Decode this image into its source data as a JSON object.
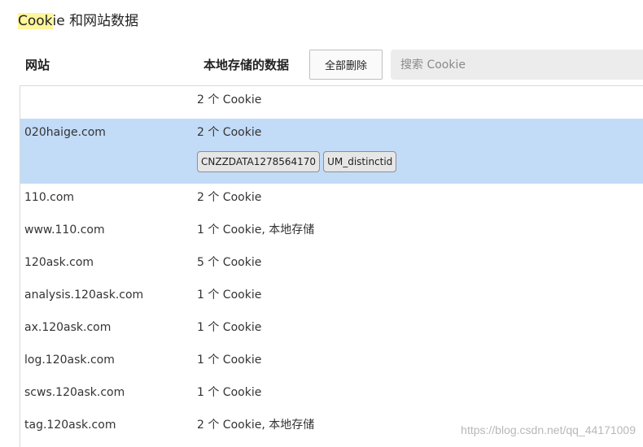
{
  "header": {
    "title_highlight": "Cook",
    "title_rest": "ie 和网站数据"
  },
  "toolbar": {
    "site_column": "网站",
    "data_column": "本地存储的数据",
    "delete_all_label": "全部删除",
    "search_placeholder": "搜索 Cookie"
  },
  "rows": [
    {
      "site": "",
      "data": "2 个 Cookie"
    },
    {
      "site": "020haige.com",
      "data": "2 个 Cookie",
      "selected": true,
      "cookies": [
        "CNZZDATA1278564170",
        "UM_distinctid"
      ]
    },
    {
      "site": "110.com",
      "data": "2 个 Cookie"
    },
    {
      "site": "www.110.com",
      "data": "1 个 Cookie, 本地存储"
    },
    {
      "site": "120ask.com",
      "data": "5 个 Cookie"
    },
    {
      "site": "analysis.120ask.com",
      "data": "1 个 Cookie"
    },
    {
      "site": "ax.120ask.com",
      "data": "1 个 Cookie"
    },
    {
      "site": "log.120ask.com",
      "data": "1 个 Cookie"
    },
    {
      "site": "scws.120ask.com",
      "data": "1 个 Cookie"
    },
    {
      "site": "tag.120ask.com",
      "data": "2 个 Cookie, 本地存储"
    }
  ],
  "watermark": "https://blog.csdn.net/qq_44171009",
  "colors": {
    "selected_row": "#c2dbf7",
    "title_highlight": "#fff59a"
  }
}
